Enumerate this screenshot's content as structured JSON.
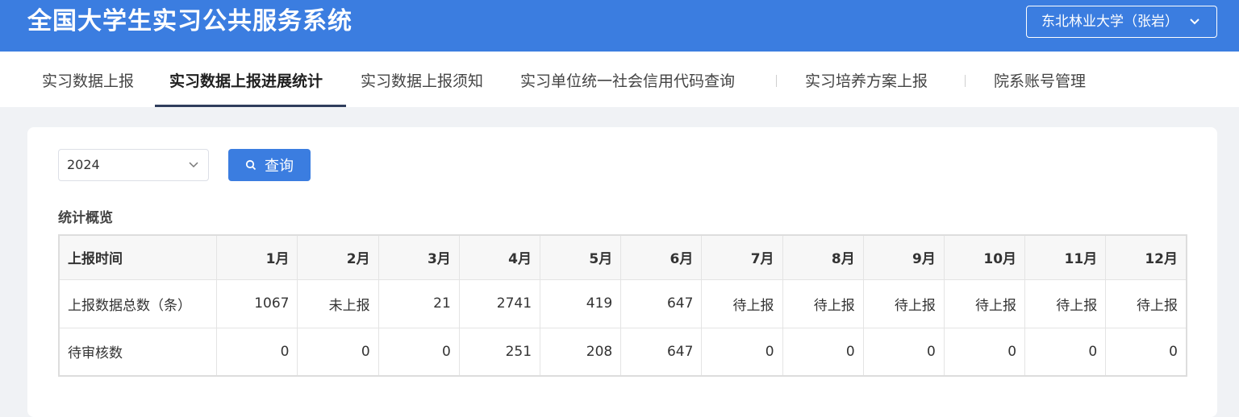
{
  "app": {
    "title": "全国大学生实习公共服务系统"
  },
  "user": {
    "label": "东北林业大学（张岩）"
  },
  "nav": {
    "tabs": [
      {
        "label": "实习数据上报"
      },
      {
        "label": "实习数据上报进展统计"
      },
      {
        "label": "实习数据上报须知"
      },
      {
        "label": "实习单位统一社会信用代码查询"
      },
      {
        "label": "实习培养方案上报"
      },
      {
        "label": "院系账号管理"
      }
    ],
    "active_index": 1
  },
  "filter": {
    "year": "2024",
    "query_label": "查询"
  },
  "overview": {
    "title": "统计概览",
    "headers": [
      "上报时间",
      "1月",
      "2月",
      "3月",
      "4月",
      "5月",
      "6月",
      "7月",
      "8月",
      "9月",
      "10月",
      "11月",
      "12月"
    ],
    "rows": [
      [
        "上报数据总数（条）",
        "1067",
        "未上报",
        "21",
        "2741",
        "419",
        "647",
        "待上报",
        "待上报",
        "待上报",
        "待上报",
        "待上报",
        "待上报"
      ],
      [
        "待审核数",
        "0",
        "0",
        "0",
        "251",
        "208",
        "647",
        "0",
        "0",
        "0",
        "0",
        "0",
        "0"
      ]
    ]
  },
  "colors": {
    "primary": "#3b7de0",
    "nav_underline": "#2f3d5c",
    "page_bg": "#f0f2f5"
  },
  "icons": {
    "user_select": "chevron-down-icon",
    "year_select": "chevron-down-icon",
    "query": "search-icon"
  }
}
